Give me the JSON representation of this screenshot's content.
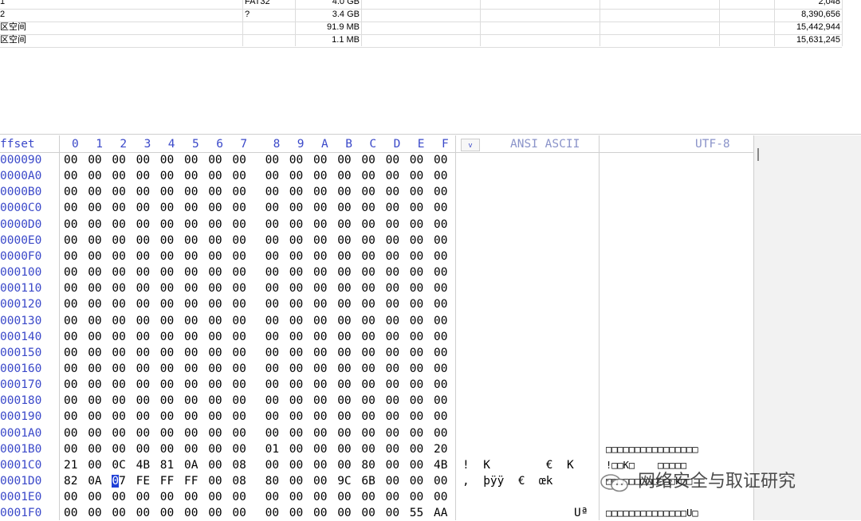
{
  "partitions": [
    {
      "name": "1",
      "fs": "FAT32",
      "size": "4.0 GB",
      "sector": "2,048"
    },
    {
      "name": "2",
      "fs": "?",
      "size": "3.4 GB",
      "sector": "8,390,656"
    },
    {
      "name": "区空间",
      "fs": "",
      "size": "91.9 MB",
      "sector": "15,442,944"
    },
    {
      "name": "区空间",
      "fs": "",
      "size": "1.1 MB",
      "sector": "15,631,245"
    }
  ],
  "hex": {
    "offset_label": "ffset",
    "columns": [
      "0",
      "1",
      "2",
      "3",
      "4",
      "5",
      "6",
      "7",
      "8",
      "9",
      "A",
      "B",
      "C",
      "D",
      "E",
      "F"
    ],
    "dropdown_glyph": "v",
    "ansi_header": "ANSI ASCII",
    "utf8_header": "UTF-8",
    "rows": [
      {
        "off": "000090",
        "b": [
          "00",
          "00",
          "00",
          "00",
          "00",
          "00",
          "00",
          "00",
          "00",
          "00",
          "00",
          "00",
          "00",
          "00",
          "00",
          "00"
        ],
        "ansi": "",
        "utf8": ""
      },
      {
        "off": "0000A0",
        "b": [
          "00",
          "00",
          "00",
          "00",
          "00",
          "00",
          "00",
          "00",
          "00",
          "00",
          "00",
          "00",
          "00",
          "00",
          "00",
          "00"
        ],
        "ansi": "",
        "utf8": ""
      },
      {
        "off": "0000B0",
        "b": [
          "00",
          "00",
          "00",
          "00",
          "00",
          "00",
          "00",
          "00",
          "00",
          "00",
          "00",
          "00",
          "00",
          "00",
          "00",
          "00"
        ],
        "ansi": "",
        "utf8": ""
      },
      {
        "off": "0000C0",
        "b": [
          "00",
          "00",
          "00",
          "00",
          "00",
          "00",
          "00",
          "00",
          "00",
          "00",
          "00",
          "00",
          "00",
          "00",
          "00",
          "00"
        ],
        "ansi": "",
        "utf8": ""
      },
      {
        "off": "0000D0",
        "b": [
          "00",
          "00",
          "00",
          "00",
          "00",
          "00",
          "00",
          "00",
          "00",
          "00",
          "00",
          "00",
          "00",
          "00",
          "00",
          "00"
        ],
        "ansi": "",
        "utf8": ""
      },
      {
        "off": "0000E0",
        "b": [
          "00",
          "00",
          "00",
          "00",
          "00",
          "00",
          "00",
          "00",
          "00",
          "00",
          "00",
          "00",
          "00",
          "00",
          "00",
          "00"
        ],
        "ansi": "",
        "utf8": ""
      },
      {
        "off": "0000F0",
        "b": [
          "00",
          "00",
          "00",
          "00",
          "00",
          "00",
          "00",
          "00",
          "00",
          "00",
          "00",
          "00",
          "00",
          "00",
          "00",
          "00"
        ],
        "ansi": "",
        "utf8": ""
      },
      {
        "off": "000100",
        "b": [
          "00",
          "00",
          "00",
          "00",
          "00",
          "00",
          "00",
          "00",
          "00",
          "00",
          "00",
          "00",
          "00",
          "00",
          "00",
          "00"
        ],
        "ansi": "",
        "utf8": ""
      },
      {
        "off": "000110",
        "b": [
          "00",
          "00",
          "00",
          "00",
          "00",
          "00",
          "00",
          "00",
          "00",
          "00",
          "00",
          "00",
          "00",
          "00",
          "00",
          "00"
        ],
        "ansi": "",
        "utf8": ""
      },
      {
        "off": "000120",
        "b": [
          "00",
          "00",
          "00",
          "00",
          "00",
          "00",
          "00",
          "00",
          "00",
          "00",
          "00",
          "00",
          "00",
          "00",
          "00",
          "00"
        ],
        "ansi": "",
        "utf8": ""
      },
      {
        "off": "000130",
        "b": [
          "00",
          "00",
          "00",
          "00",
          "00",
          "00",
          "00",
          "00",
          "00",
          "00",
          "00",
          "00",
          "00",
          "00",
          "00",
          "00"
        ],
        "ansi": "",
        "utf8": ""
      },
      {
        "off": "000140",
        "b": [
          "00",
          "00",
          "00",
          "00",
          "00",
          "00",
          "00",
          "00",
          "00",
          "00",
          "00",
          "00",
          "00",
          "00",
          "00",
          "00"
        ],
        "ansi": "",
        "utf8": ""
      },
      {
        "off": "000150",
        "b": [
          "00",
          "00",
          "00",
          "00",
          "00",
          "00",
          "00",
          "00",
          "00",
          "00",
          "00",
          "00",
          "00",
          "00",
          "00",
          "00"
        ],
        "ansi": "",
        "utf8": ""
      },
      {
        "off": "000160",
        "b": [
          "00",
          "00",
          "00",
          "00",
          "00",
          "00",
          "00",
          "00",
          "00",
          "00",
          "00",
          "00",
          "00",
          "00",
          "00",
          "00"
        ],
        "ansi": "",
        "utf8": ""
      },
      {
        "off": "000170",
        "b": [
          "00",
          "00",
          "00",
          "00",
          "00",
          "00",
          "00",
          "00",
          "00",
          "00",
          "00",
          "00",
          "00",
          "00",
          "00",
          "00"
        ],
        "ansi": "",
        "utf8": ""
      },
      {
        "off": "000180",
        "b": [
          "00",
          "00",
          "00",
          "00",
          "00",
          "00",
          "00",
          "00",
          "00",
          "00",
          "00",
          "00",
          "00",
          "00",
          "00",
          "00"
        ],
        "ansi": "",
        "utf8": ""
      },
      {
        "off": "000190",
        "b": [
          "00",
          "00",
          "00",
          "00",
          "00",
          "00",
          "00",
          "00",
          "00",
          "00",
          "00",
          "00",
          "00",
          "00",
          "00",
          "00"
        ],
        "ansi": "",
        "utf8": ""
      },
      {
        "off": "0001A0",
        "b": [
          "00",
          "00",
          "00",
          "00",
          "00",
          "00",
          "00",
          "00",
          "00",
          "00",
          "00",
          "00",
          "00",
          "00",
          "00",
          "00"
        ],
        "ansi": "",
        "utf8": ""
      },
      {
        "off": "0001B0",
        "b": [
          "00",
          "00",
          "00",
          "00",
          "00",
          "00",
          "00",
          "00",
          "01",
          "00",
          "00",
          "00",
          "00",
          "00",
          "00",
          "20"
        ],
        "ansi": "",
        "utf8": "□□□□□□□□□□□□□□□□"
      },
      {
        "off": "0001C0",
        "b": [
          "21",
          "00",
          "0C",
          "4B",
          "81",
          "0A",
          "00",
          "08",
          "00",
          "00",
          "00",
          "00",
          "80",
          "00",
          "00",
          "4B"
        ],
        "ansi": "!  K        €  K",
        "utf8": "!□□K□    □□□□□"
      },
      {
        "off": "0001D0",
        "b": [
          "82",
          "0A",
          "07",
          "FE",
          "FF",
          "FF",
          "00",
          "08",
          "80",
          "00",
          "00",
          "9C",
          "6B",
          "00",
          "00",
          "00"
        ],
        "ansi": ",  þÿÿ  €  œk",
        "utf8": "□□□□□□□□□□□□k□□"
      },
      {
        "off": "0001E0",
        "b": [
          "00",
          "00",
          "00",
          "00",
          "00",
          "00",
          "00",
          "00",
          "00",
          "00",
          "00",
          "00",
          "00",
          "00",
          "00",
          "00"
        ],
        "ansi": "",
        "utf8": ""
      },
      {
        "off": "0001F0",
        "b": [
          "00",
          "00",
          "00",
          "00",
          "00",
          "00",
          "00",
          "00",
          "00",
          "00",
          "00",
          "00",
          "00",
          "00",
          "55",
          "AA"
        ],
        "ansi": "Uª",
        "utf8": "□□□□□□□□□□□□□□U□"
      }
    ],
    "cursor": {
      "row": 20,
      "col": 2
    }
  },
  "watermark": {
    "text": "网络安全与取证研究",
    "icon": "wechat-icon"
  }
}
